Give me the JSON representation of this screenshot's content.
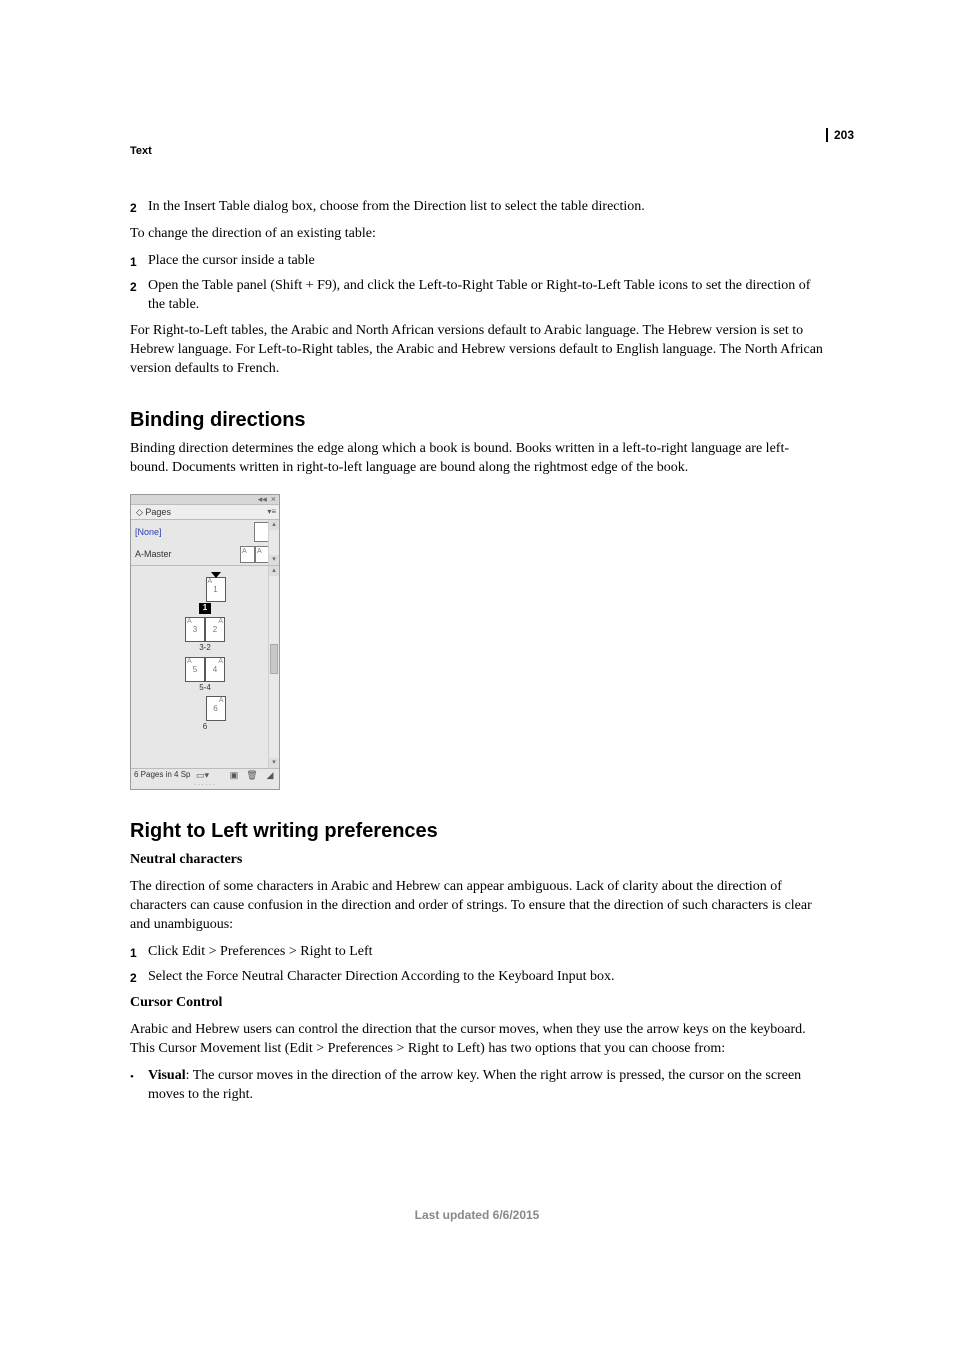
{
  "page_number": "203",
  "section_label": "Text",
  "intro": {
    "step2": "In the Insert Table dialog box, choose from the Direction list to select the table direction.",
    "change_existing": "To change the direction of an existing table:",
    "existing_step1": "Place the cursor inside a table",
    "existing_step2": "Open the Table panel (Shift + F9), and click the Left-to-Right Table or Right-to-Left Table icons to set the direction of the table.",
    "note": "For Right-to-Left tables, the Arabic and North African versions default to Arabic language. The Hebrew version is set to Hebrew language. For Left-to-Right tables, the Arabic and Hebrew versions default to English language. The North African version defaults to French."
  },
  "binding": {
    "heading": "Binding directions",
    "para": "Binding direction determines the edge along which a book is bound. Books written in a left-to-right language are left-bound. Documents written in right-to-left language are bound along the rightmost edge of the book."
  },
  "panel": {
    "tab": "◇ Pages",
    "none": "[None]",
    "a_master": "A-Master",
    "master_letter": "A",
    "spread1_label": "1",
    "spread2_label": "3-2",
    "spread3_label": "5-4",
    "spread4_label": "6",
    "p1": "1",
    "p2": "2",
    "p3": "3",
    "p4": "4",
    "p5": "5",
    "p6": "6",
    "status": "6 Pages in 4 Sp"
  },
  "rtl": {
    "heading": "Right to Left writing preferences",
    "neutral_head": "Neutral characters",
    "neutral_para": "The direction of some characters in Arabic and Hebrew can appear ambiguous. Lack of clarity about the direction of characters can cause confusion in the direction and order of strings. To ensure that the direction of such characters is clear and unambiguous:",
    "neutral_step1": "Click Edit > Preferences > Right to Left",
    "neutral_step2": "Select the Force Neutral Character Direction According to the Keyboard Input box.",
    "cursor_head": "Cursor Control",
    "cursor_para": "Arabic and Hebrew users can control the direction that the cursor moves, when they use the arrow keys on the keyboard. This Cursor Movement list (Edit > Preferences > Right to Left) has two options that you can choose from:",
    "visual_label": "Visual",
    "visual_text": ": The cursor moves in the direction of the arrow key. When the right arrow is pressed, the cursor on the screen moves to the right."
  },
  "footer": "Last updated 6/6/2015",
  "nums": {
    "n1": "1",
    "n2": "2"
  },
  "bullet": "•"
}
